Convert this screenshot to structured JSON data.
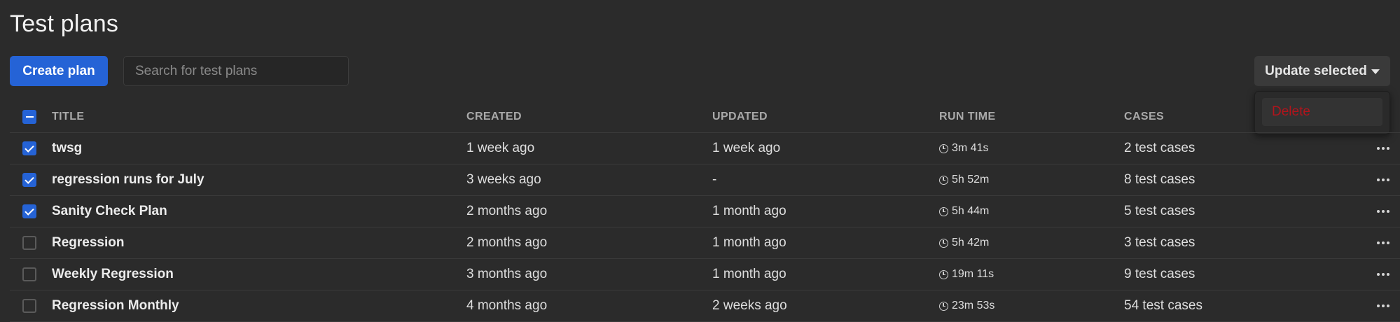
{
  "page": {
    "title": "Test plans"
  },
  "toolbar": {
    "create_label": "Create plan",
    "search_placeholder": "Search for test plans",
    "update_label": "Update selected"
  },
  "dropdown": {
    "delete_label": "Delete"
  },
  "colors": {
    "accent": "#2563d6",
    "danger": "#b3141c",
    "background": "#2b2b2b"
  },
  "table": {
    "headers": {
      "title": "TITLE",
      "created": "CREATED",
      "updated": "UPDATED",
      "run_time": "RUN TIME",
      "cases": "CASES"
    },
    "rows": [
      {
        "checked": true,
        "title": "twsg",
        "created": "1 week ago",
        "updated": "1 week ago",
        "run_time": "3m 41s",
        "cases": "2 test cases"
      },
      {
        "checked": true,
        "title": "regression runs for July",
        "created": "3 weeks ago",
        "updated": "-",
        "run_time": "5h 52m",
        "cases": "8 test cases"
      },
      {
        "checked": true,
        "title": "Sanity Check Plan",
        "created": "2 months ago",
        "updated": "1 month ago",
        "run_time": "5h 44m",
        "cases": "5 test cases"
      },
      {
        "checked": false,
        "title": "Regression",
        "created": "2 months ago",
        "updated": "1 month ago",
        "run_time": "5h 42m",
        "cases": "3 test cases"
      },
      {
        "checked": false,
        "title": "Weekly Regression",
        "created": "3 months ago",
        "updated": "1 month ago",
        "run_time": "19m 11s",
        "cases": "9 test cases"
      },
      {
        "checked": false,
        "title": "Regression Monthly",
        "created": "4 months ago",
        "updated": "2 weeks ago",
        "run_time": "23m 53s",
        "cases": "54 test cases"
      }
    ]
  }
}
